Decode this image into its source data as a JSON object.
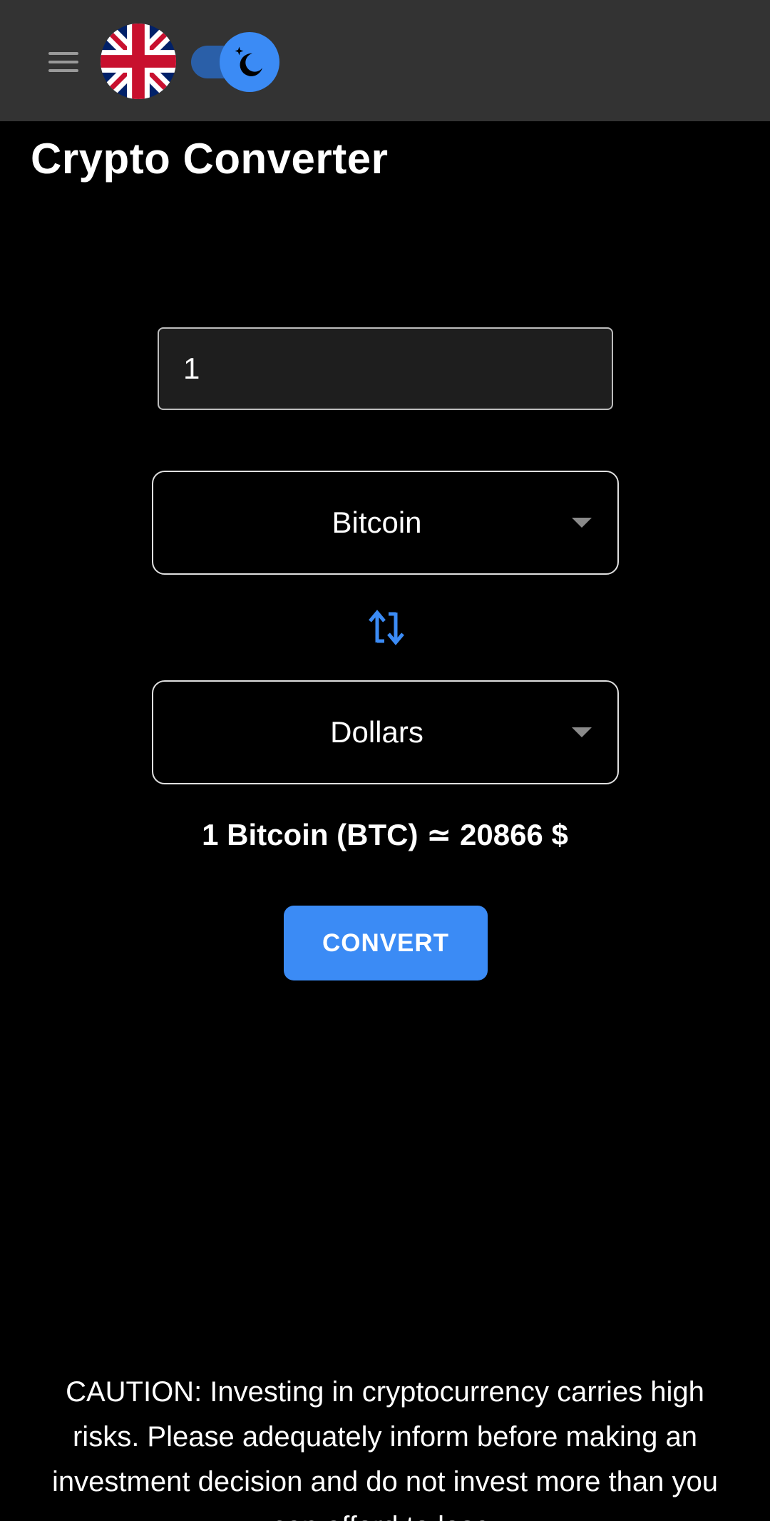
{
  "header": {
    "menu_icon": "hamburger-menu-icon",
    "language_flag": "uk-flag-icon",
    "theme_toggle_icon": "moon-stars-icon",
    "theme_mode": "dark"
  },
  "page": {
    "title": "Crypto Converter"
  },
  "converter": {
    "amount_value": "1",
    "from_currency": "Bitcoin",
    "to_currency": "Dollars",
    "swap_icon": "swap-vertical-arrows-icon",
    "result_text": "1 Bitcoin (BTC) ≃ 20866 $",
    "convert_label": "CONVERT"
  },
  "footer": {
    "caution_text": "CAUTION: Investing in cryptocurrency carries high risks. Please adequately inform before making an investment decision and do not invest more than you can afford to lose."
  },
  "colors": {
    "background": "#000000",
    "header": "#333333",
    "accent": "#3b8bf5",
    "input_background": "#1e1e1e"
  }
}
